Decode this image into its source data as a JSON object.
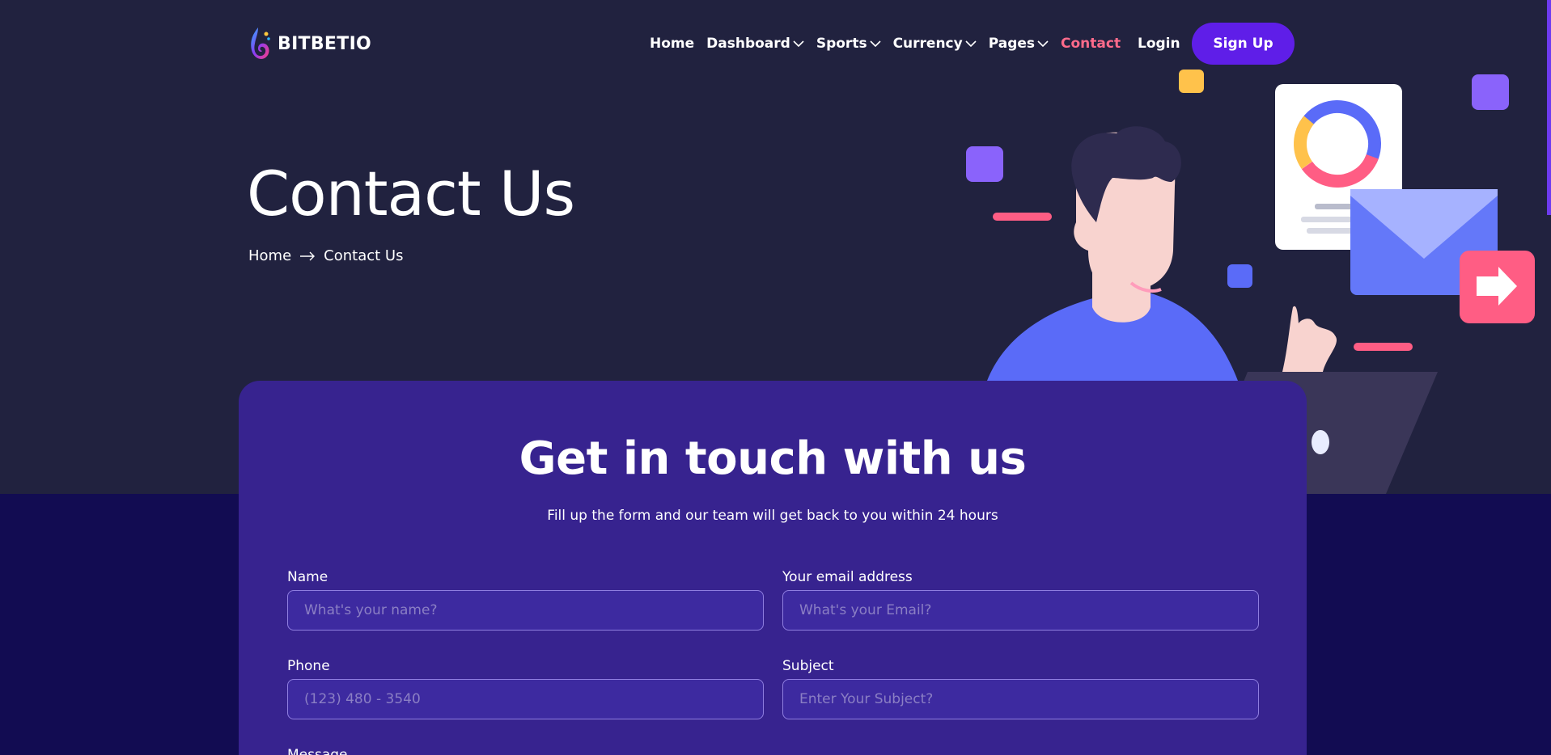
{
  "header": {
    "brand": "BITBETIO",
    "nav": [
      {
        "label": "Home",
        "dropdown": false,
        "active": false
      },
      {
        "label": "Dashboard",
        "dropdown": true,
        "active": false
      },
      {
        "label": "Sports",
        "dropdown": true,
        "active": false
      },
      {
        "label": "Currency",
        "dropdown": true,
        "active": false
      },
      {
        "label": "Pages",
        "dropdown": true,
        "active": false
      },
      {
        "label": "Contact",
        "dropdown": false,
        "active": true
      }
    ],
    "login_label": "Login",
    "signup_label": "Sign Up"
  },
  "hero": {
    "title": "Contact Us",
    "breadcrumb": {
      "home": "Home",
      "current": "Contact Us"
    }
  },
  "form": {
    "title": "Get in touch with us",
    "subtitle": "Fill up the form and our team will get back to you within 24 hours",
    "name": {
      "label": "Name",
      "placeholder": "What's your name?",
      "value": ""
    },
    "email": {
      "label": "Your email address",
      "placeholder": "What's your Email?",
      "value": ""
    },
    "phone": {
      "label": "Phone",
      "placeholder": "(123) 480 - 3540",
      "value": ""
    },
    "subject": {
      "label": "Subject",
      "placeholder": "Enter Your Subject?",
      "value": ""
    },
    "message": {
      "label": "Message"
    }
  },
  "colors": {
    "hero_bg": "#21223f",
    "page_bg": "#120c52",
    "card_bg": "#37238f",
    "accent": "#5f1ee8",
    "active_link": "#ff6b8b"
  },
  "icons": [
    "logo-flame-icon",
    "chevron-down-icon",
    "arrow-right-icon",
    "envelope-icon"
  ]
}
